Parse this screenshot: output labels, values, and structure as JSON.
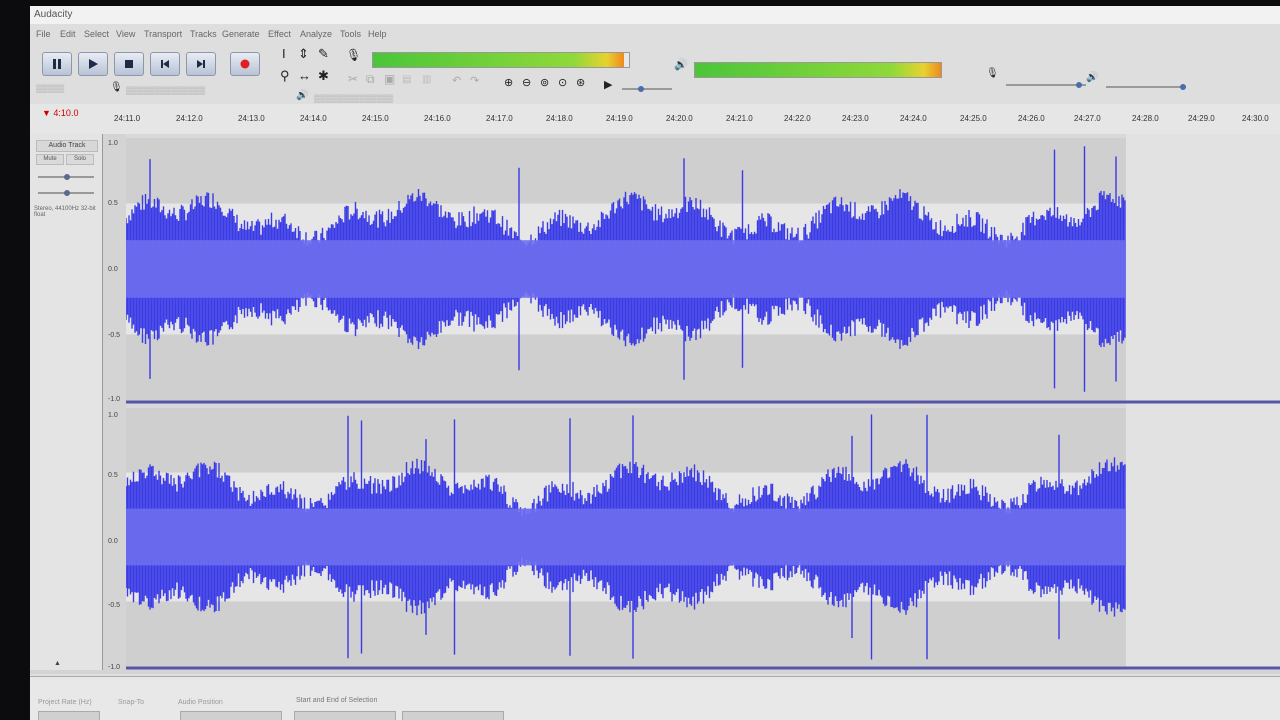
{
  "window": {
    "title": "Audacity"
  },
  "menu": [
    "File",
    "Edit",
    "Select",
    "View",
    "Transport",
    "Tracks",
    "Generate",
    "Effect",
    "Analyze",
    "Tools",
    "Help"
  ],
  "transport": {
    "buttons": [
      {
        "name": "pause-button",
        "icon": "pause-icon"
      },
      {
        "name": "play-button",
        "icon": "play-icon"
      },
      {
        "name": "stop-button",
        "icon": "stop-icon"
      },
      {
        "name": "skip-start-button",
        "icon": "skip-start-icon"
      },
      {
        "name": "skip-end-button",
        "icon": "skip-end-icon"
      },
      {
        "name": "record-button",
        "icon": "record-icon"
      }
    ]
  },
  "timeline": {
    "position": "4:10.0",
    "ticks": [
      "24:11.0",
      "24:12.0",
      "24:13.0",
      "24:14.0",
      "24:15.0",
      "24:16.0",
      "24:17.0",
      "24:18.0",
      "24:19.0",
      "24:20.0",
      "24:21.0",
      "24:22.0",
      "24:23.0",
      "24:24.0",
      "24:25.0",
      "24:26.0",
      "24:27.0",
      "24:28.0",
      "24:29.0",
      "24:30.0"
    ]
  },
  "track": {
    "name": "Audio Track",
    "mute": "Mute",
    "solo": "Solo",
    "info": "Stereo, 44100Hz 32-bit float",
    "scale": [
      "1.0",
      "0.5",
      "0.0",
      "-0.5",
      "-1.0"
    ]
  },
  "bottom": {
    "project_rate_label": "Project Rate (Hz)",
    "snap_label": "Snap-To",
    "audio_position_label": "Audio Position",
    "selection_label": "Start and End of Selection"
  },
  "colors": {
    "waveform": "#3a3ae6",
    "waveform_rms": "#6e6ef0",
    "track_bg": "#d4d4d4",
    "meter_green": "#4bc53a"
  }
}
